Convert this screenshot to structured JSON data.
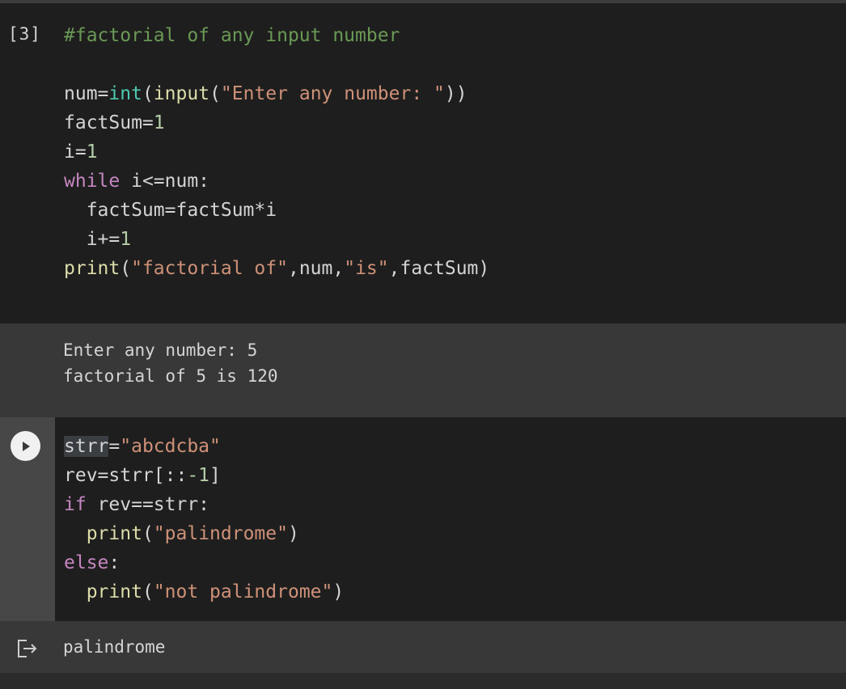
{
  "cell1": {
    "execution_count": "[3]",
    "code": {
      "comment": "#factorial of any input number",
      "l1_num": "num",
      "l1_eq": "=",
      "l1_int": "int",
      "l1_p1": "(",
      "l1_input": "input",
      "l1_p2": "(",
      "l1_str": "\"Enter any number: \"",
      "l1_p3": "))",
      "l2_a": "factSum=",
      "l2_n": "1",
      "l3_a": "i=",
      "l3_n": "1",
      "l4_kw": "while",
      "l4_rest": " i<=num:",
      "l5": "  factSum=factSum*i",
      "l6_a": "  i+=",
      "l6_n": "1",
      "l7_fn": "print",
      "l7_p": "(",
      "l7_s1": "\"factorial of\"",
      "l7_m": ",num,",
      "l7_s2": "\"is\"",
      "l7_end": ",factSum)"
    },
    "output_lines": "Enter any number: 5\nfactorial of 5 is 120"
  },
  "cell2": {
    "code": {
      "l1_var": "strr",
      "l1_eq": "=",
      "l1_str": "\"abcdcba\"",
      "l2_a": "rev=strr[::",
      "l2_n": "-1",
      "l2_b": "]",
      "l3_kw": "if",
      "l3_rest": " rev==strr:",
      "l4_ind": "  ",
      "l4_fn": "print",
      "l4_p": "(",
      "l4_s": "\"palindrome\"",
      "l4_e": ")",
      "l5_kw": "else",
      "l5_c": ":",
      "l6_ind": "  ",
      "l6_fn": "print",
      "l6_p": "(",
      "l6_s": "\"not palindrome\"",
      "l6_e": ")"
    },
    "output": "palindrome"
  },
  "icons": {
    "run": "play-icon",
    "output": "output-arrow-icon"
  },
  "colors": {
    "cell_bg": "#1e1e1e",
    "output_bg": "#383838",
    "keyword": "#c586c0",
    "builtin": "#4ec9b0",
    "function": "#dcdcaa",
    "string": "#ce9178",
    "number": "#b5cea8",
    "comment": "#6a9955"
  }
}
